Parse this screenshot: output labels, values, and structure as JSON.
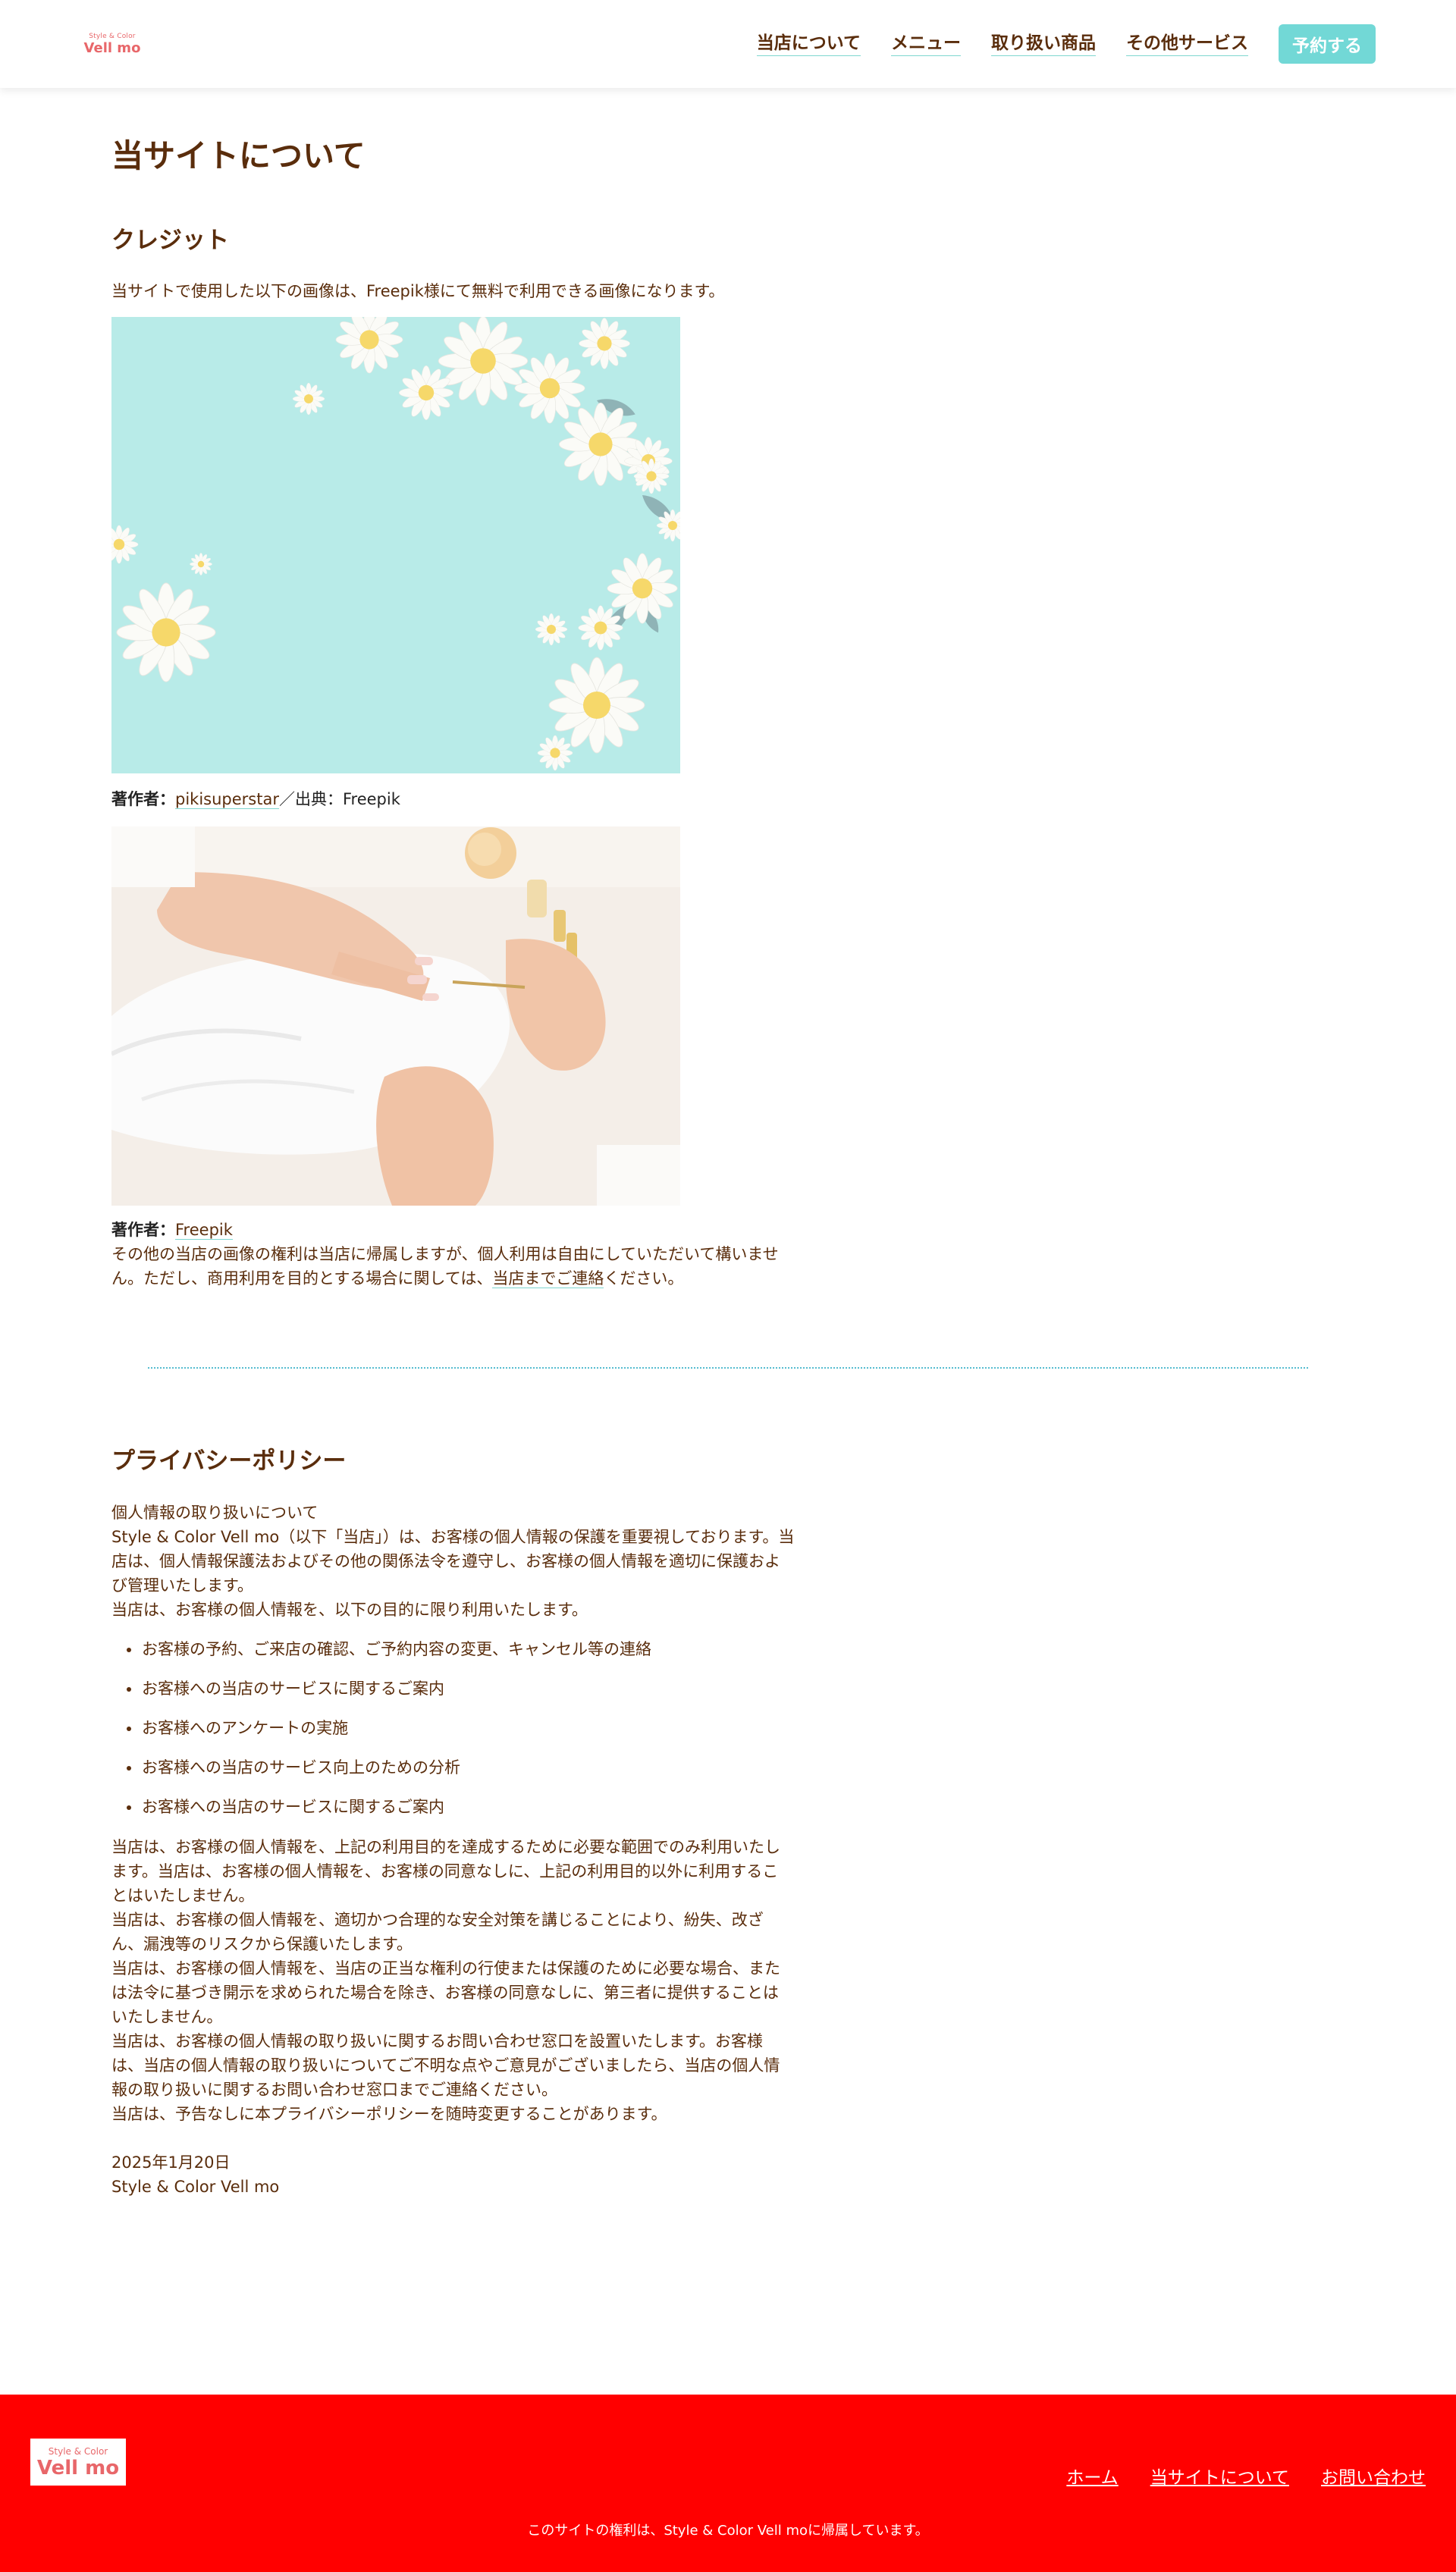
{
  "header": {
    "logo_small": "Style & Color",
    "logo_big": "Vell mo",
    "nav": [
      "当店について",
      "メニュー",
      "取り扱い商品",
      "その他サービス"
    ],
    "reserve_label": "予約する"
  },
  "page": {
    "title": "当サイトについて"
  },
  "credit": {
    "heading": "クレジット",
    "intro": "当サイトで使用した以下の画像は、Freepik様にて無料で利用できる画像になります。",
    "image1_alt": "",
    "credit1_label": "著作者：",
    "credit1_author": "pikisuperstar",
    "credit1_sep": "／出典：",
    "credit1_source": "Freepik",
    "credit2_label": "著作者：",
    "credit2_author": "Freepik",
    "note_line1": "その他の当店の画像の権利は当店に帰属しますが、個人利用は自由にしていただいて構いませ",
    "note_line2_a": "ん。ただし、商用利用を目的とする場合に関しては、",
    "note_line2_link": "当店までご連絡",
    "note_line2_b": "ください。"
  },
  "privacy": {
    "heading": "プライバシーポリシー",
    "intro_lines": [
      "個人情報の取り扱いについて",
      "Style & Color Vell mo（以下「当店」）は、お客様の個人情報の保護を重要視しております。当",
      "店は、個人情報保護法およびその他の関係法令を遵守し、お客様の個人情報を適切に保護およ",
      "び管理いたします。",
      "当店は、お客様の個人情報を、以下の目的に限り利用いたします。"
    ],
    "purposes": [
      "お客様の予約、ご来店の確認、ご予約内容の変更、キャンセル等の連絡",
      "お客様への当店のサービスに関するご案内",
      "お客様へのアンケートの実施",
      "お客様への当店のサービス向上のための分析",
      "お客様への当店のサービスに関するご案内"
    ],
    "body_lines": [
      "当店は、お客様の個人情報を、上記の利用目的を達成するために必要な範囲でのみ利用いたし",
      "ます。当店は、お客様の個人情報を、お客様の同意なしに、上記の利用目的以外に利用するこ",
      "とはいたしません。",
      "当店は、お客様の個人情報を、適切かつ合理的な安全対策を講じることにより、紛失、改ざ",
      "ん、漏洩等のリスクから保護いたします。",
      "当店は、お客様の個人情報を、当店の正当な権利の行使または保護のために必要な場合、また",
      "は法令に基づき開示を求められた場合を除き、お客様の同意なしに、第三者に提供することは",
      "いたしません。",
      "当店は、お客様の個人情報の取り扱いに関するお問い合わせ窓口を設置いたします。お客様",
      "は、当店の個人情報の取り扱いについてご不明な点やご意見がございましたら、当店の個人情",
      "報の取り扱いに関するお問い合わせ窓口までご連絡ください。",
      "当店は、予告なしに本プライバシーポリシーを随時変更することがあります。"
    ],
    "date": "2025年1月20日",
    "signature": "Style & Color Vell mo"
  },
  "footer": {
    "logo_small": "Style & Color",
    "logo_big": "Vell mo",
    "nav": [
      "ホーム",
      "当サイトについて",
      "お問い合わせ"
    ],
    "copyright": "このサイトの権利は、Style & Color Vell moに帰属しています。"
  },
  "colors": {
    "text": "#5a2d0c",
    "accent": "#72d8d6",
    "footer_bg": "#ff0000",
    "logo": "#e8676a"
  }
}
